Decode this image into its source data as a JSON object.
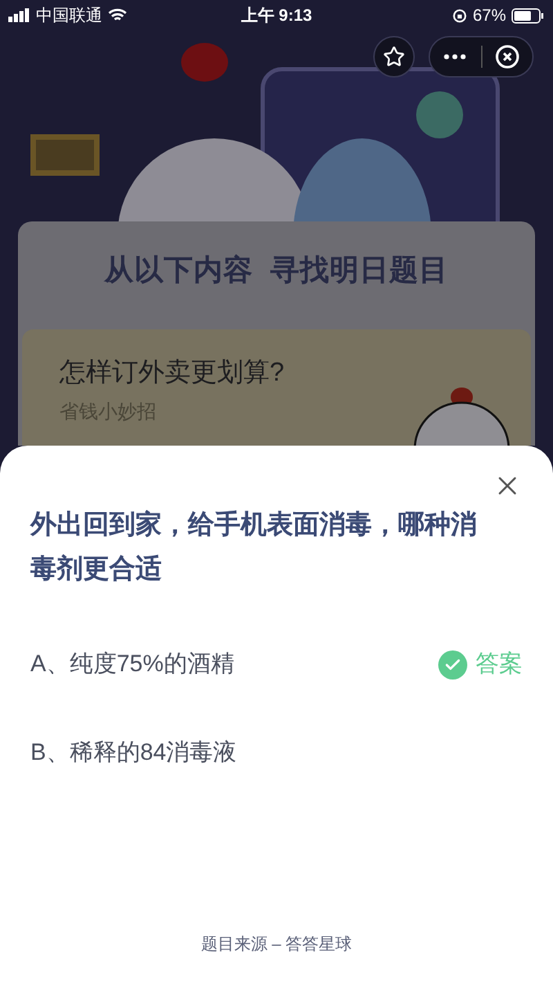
{
  "status_bar": {
    "carrier": "中国联通",
    "time": "上午 9:13",
    "battery": "67%"
  },
  "headline": "从以下内容  寻找明日题目",
  "article": {
    "title": "怎样订外卖更划算?",
    "subtitle": "省钱小妙招"
  },
  "sheet": {
    "question": "外出回到家，给手机表面消毒，哪种消毒剂更合适",
    "answer_label": "答案",
    "options": [
      {
        "text": "A、纯度75%的酒精",
        "correct": true
      },
      {
        "text": "B、稀释的84消毒液",
        "correct": false
      }
    ],
    "source": "题目来源 – 答答星球"
  }
}
